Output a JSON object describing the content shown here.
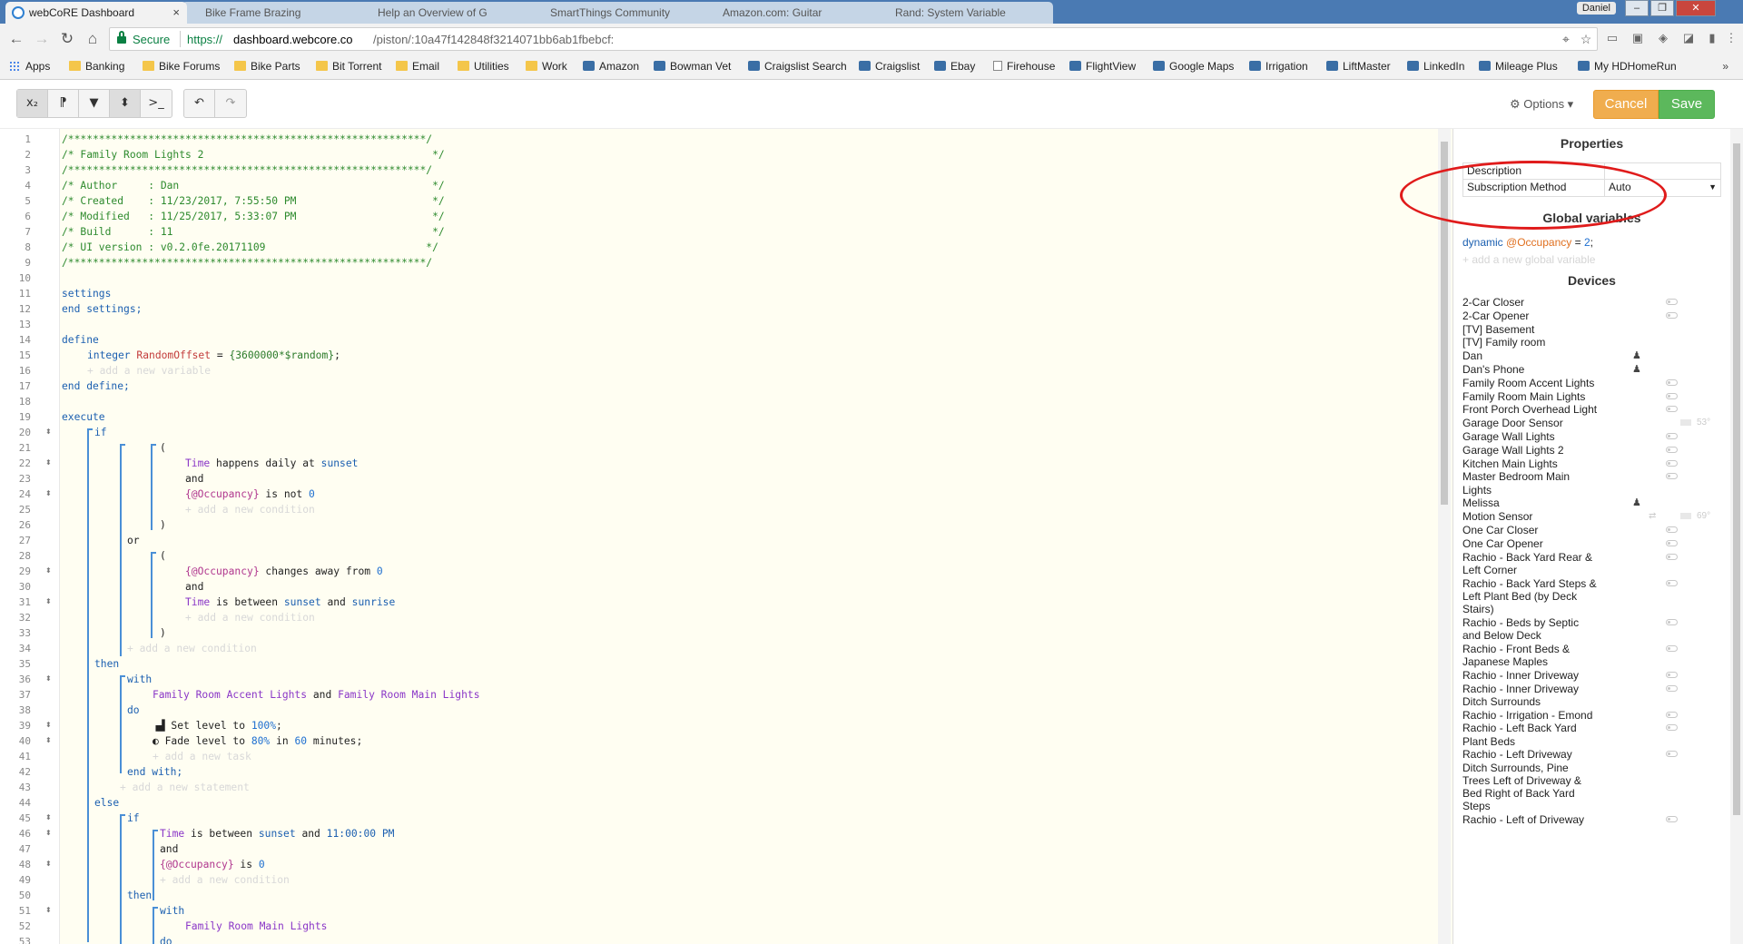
{
  "browser": {
    "tabs": [
      {
        "title": "webCoRE Dashboard"
      },
      {
        "title": "Bike Frame Brazing"
      },
      {
        "title": "Help an Overview of G"
      },
      {
        "title": "SmartThings Community"
      },
      {
        "title": "Amazon.com: Guitar"
      },
      {
        "title": "Rand: System Variable"
      }
    ],
    "window_user": "Daniel",
    "secure_label": "Secure",
    "url_scheme": "https://",
    "url_host": "dashboard.webcore.co",
    "url_path": "/piston/:10a47f142848f3214071bb6ab1fbebcf:"
  },
  "bookmarks": [
    {
      "label": "Apps",
      "icon": "grid"
    },
    {
      "label": "Banking",
      "icon": "folder"
    },
    {
      "label": "Bike Forums",
      "icon": "folder"
    },
    {
      "label": "Bike Parts",
      "icon": "folder"
    },
    {
      "label": "Bit Torrent",
      "icon": "folder"
    },
    {
      "label": "Email",
      "icon": "folder"
    },
    {
      "label": "Utilities",
      "icon": "folder"
    },
    {
      "label": "Work",
      "icon": "folder"
    },
    {
      "label": "Amazon",
      "icon": "generic"
    },
    {
      "label": "Bowman Vet",
      "icon": "generic"
    },
    {
      "label": "Craigslist Search",
      "icon": "generic"
    },
    {
      "label": "Craigslist",
      "icon": "generic"
    },
    {
      "label": "Ebay",
      "icon": "generic"
    },
    {
      "label": "Firehouse",
      "icon": "page"
    },
    {
      "label": "FlightView",
      "icon": "generic"
    },
    {
      "label": "Google Maps",
      "icon": "generic"
    },
    {
      "label": "Irrigation",
      "icon": "generic"
    },
    {
      "label": "LiftMaster",
      "icon": "generic"
    },
    {
      "label": "LinkedIn",
      "icon": "generic"
    },
    {
      "label": "Mileage Plus",
      "icon": "generic"
    },
    {
      "label": "My HDHomeRun",
      "icon": "generic"
    }
  ],
  "bookmarks_more": "»",
  "toolbar": {
    "buttons": [
      "x₂",
      "⁋",
      "▼",
      "⬍",
      ">_"
    ],
    "undo": "↶",
    "redo": "↷",
    "options_label": "⚙ Options ▾",
    "cancel_label": "Cancel",
    "save_label": "Save"
  },
  "editor": {
    "header": {
      "stars": "/**********************************************************/",
      "title": "/* Family Room Lights 2                                     */",
      "author": "/* Author     : Dan                                         */",
      "created": "/* Created    : 11/23/2017, 7:55:50 PM                      */",
      "modified": "/* Modified   : 11/25/2017, 5:33:07 PM                      */",
      "build": "/* Build      : 11                                          */",
      "ui_version": "/* UI version : v0.2.0fe.20171109                          */"
    },
    "kw": {
      "settings": "settings",
      "end_settings": "end settings;",
      "define": "define",
      "integer": "integer",
      "end_define": "end define;",
      "execute": "execute",
      "if": "if",
      "open_paren": "(",
      "close_paren": ")",
      "and": "and",
      "or": "or",
      "then": "then",
      "with": "with",
      "do": "do",
      "end_with": "end with;",
      "else": "else"
    },
    "define_var": "RandomOffset",
    "define_eq": " = ",
    "define_val": "{3600000*$random}",
    "define_semi": ";",
    "ghost": {
      "add_variable": "+ add a new variable",
      "add_condition": "+ add a new condition",
      "add_task": "+ add a new task",
      "add_statement": "+ add a new statement"
    },
    "cond": {
      "time": "Time",
      "happens_daily_at": " happens daily at ",
      "sunset": "sunset",
      "occupancy_var": "{@Occupancy}",
      "is_not": " is not ",
      "zero": "0",
      "changes_away_from": " changes away from ",
      "is_between": " is between ",
      "and_word": " and ",
      "sunrise": "sunrise",
      "eleven_pm": "11:00:00 PM",
      "is": " is "
    },
    "devices_line": {
      "dev1": "Family Room Accent Lights",
      "and": " and ",
      "dev2": "Family Room Main Lights"
    },
    "tasks": {
      "set_level": "Set level to ",
      "set_value": "100%",
      "set_end": ";",
      "fade_level": "Fade level to ",
      "fade_value": "80%",
      "fade_in": " in ",
      "fade_minutes": "60",
      "fade_end": " minutes;"
    },
    "else_device": "Family Room Main Lights"
  },
  "panel": {
    "properties_title": "Properties",
    "properties": [
      {
        "key": "Description",
        "value": ""
      },
      {
        "key": "Subscription Method",
        "value": "Auto"
      }
    ],
    "global_title": "Global variables",
    "global_var": {
      "type": "dynamic",
      "name": "@Occupancy",
      "eq": " = ",
      "value": "2",
      "semi": ";"
    },
    "global_add": "+ add a new global variable",
    "devices_title": "Devices",
    "devices": [
      {
        "name": "2-Car Closer",
        "kind": "toggle"
      },
      {
        "name": "2-Car Opener",
        "kind": "toggle"
      },
      {
        "name": "[TV] Basement",
        "kind": "none"
      },
      {
        "name": "[TV] Family room",
        "kind": "none"
      },
      {
        "name": "Dan",
        "kind": "person"
      },
      {
        "name": "Dan's Phone",
        "kind": "person"
      },
      {
        "name": "Family Room Accent Lights",
        "kind": "toggle"
      },
      {
        "name": "Family Room Main Lights",
        "kind": "toggle"
      },
      {
        "name": "Front Porch Overhead Light",
        "kind": "toggle"
      },
      {
        "name": "Garage Door Sensor",
        "kind": "temp",
        "temp": "53°"
      },
      {
        "name": "Garage Wall Lights",
        "kind": "toggle"
      },
      {
        "name": "Garage Wall Lights 2",
        "kind": "toggle"
      },
      {
        "name": "Kitchen Main Lights",
        "kind": "toggle"
      },
      {
        "name": "Master Bedroom Main Lights",
        "kind": "toggle"
      },
      {
        "name": "Melissa",
        "kind": "person"
      },
      {
        "name": "Motion Sensor",
        "kind": "motion",
        "temp": "69°"
      },
      {
        "name": "One Car Closer",
        "kind": "toggle"
      },
      {
        "name": "One Car Opener",
        "kind": "toggle"
      },
      {
        "name": "Rachio - Back Yard Rear & Left Corner",
        "kind": "toggle"
      },
      {
        "name": "Rachio - Back Yard Steps & Left Plant Bed (by Deck Stairs)",
        "kind": "toggle"
      },
      {
        "name": "Rachio - Beds by Septic and Below Deck",
        "kind": "toggle"
      },
      {
        "name": "Rachio - Front Beds & Japanese Maples",
        "kind": "toggle"
      },
      {
        "name": "Rachio - Inner Driveway",
        "kind": "toggle"
      },
      {
        "name": "Rachio - Inner Driveway Ditch Surrounds",
        "kind": "toggle"
      },
      {
        "name": "Rachio - Irrigation - Emond",
        "kind": "toggle"
      },
      {
        "name": "Rachio - Left Back Yard Plant Beds",
        "kind": "toggle"
      },
      {
        "name": "Rachio - Left Driveway Ditch Surrounds, Pine Trees Left of Driveway & Bed Right of Back Yard Steps",
        "kind": "toggle"
      },
      {
        "name": "Rachio - Left of Driveway",
        "kind": "toggle"
      }
    ]
  },
  "colors": {
    "accent": "#1b5fb0",
    "cancel": "#f0ad4e",
    "save": "#5cb85c",
    "annotation": "#e01b1b"
  }
}
